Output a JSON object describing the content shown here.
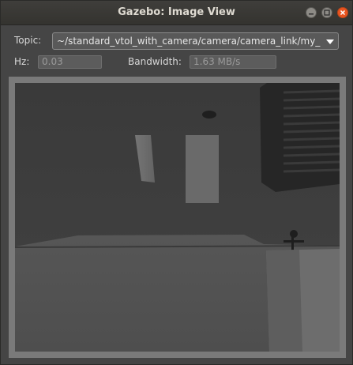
{
  "window": {
    "title": "Gazebo: Image View",
    "buttons": [
      "minimize",
      "maximize",
      "close"
    ]
  },
  "topic": {
    "label": "Topic:",
    "value": "~/standard_vtol_with_camera/camera/camera_link/my_c"
  },
  "hz": {
    "label": "Hz:",
    "value": "0.03"
  },
  "bandwidth": {
    "label": "Bandwidth:",
    "value": "1.63 MB/s"
  },
  "colors": {
    "titlebar": "#3c3b37",
    "window_bg": "#454545",
    "close_button": "#e95420",
    "image_frame": "#7a7a7a"
  },
  "icons": {
    "minimize": "minimize-icon",
    "maximize": "maximize-icon",
    "close": "close-icon",
    "dropdown": "chevron-down-icon"
  }
}
